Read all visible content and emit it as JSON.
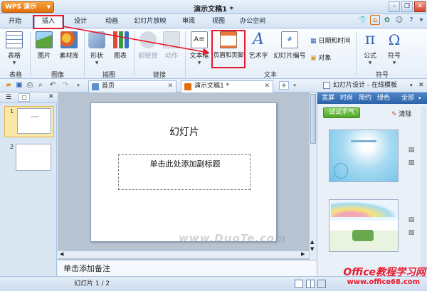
{
  "app": {
    "name": "WPS 演示",
    "doc_title": "演示文稿1 *"
  },
  "menu": {
    "tabs": [
      "开始",
      "插入",
      "设计",
      "动画",
      "幻灯片放映",
      "审阅",
      "视图",
      "办公空间"
    ],
    "active": "插入"
  },
  "ribbon": {
    "buttons": {
      "table": "表格",
      "picture": "图片",
      "clipart": "素材库",
      "shape": "形状",
      "chart": "图表",
      "hyperlink": "超链接",
      "action": "动作",
      "textbox": "文本框",
      "header_footer": "页眉和页脚",
      "wordart": "艺术字",
      "slide_number": "幻灯片编号",
      "datetime": "日期和时间",
      "object": "对象",
      "formula": "公式",
      "symbol": "符号"
    },
    "groups": {
      "table": "表格",
      "image": "图像",
      "illustration": "插图",
      "link": "链接",
      "text": "文本",
      "symbol": "符号"
    }
  },
  "doc_tabs": [
    {
      "label": "首页"
    },
    {
      "label": "演示文稿1 *"
    }
  ],
  "slide": {
    "title": "幻灯片",
    "subtitle_placeholder": "单击此处添加副标题",
    "watermark": "www.DuoTe.com"
  },
  "thumbnails": [
    {
      "num": "1"
    },
    {
      "num": "2"
    }
  ],
  "notes": {
    "placeholder": "单击添加备注"
  },
  "right_panel": {
    "title": "幻灯片设计 - 在线模板",
    "categories": [
      "宽屏",
      "时尚",
      "简约",
      "绿色",
      "全部"
    ],
    "try_button": "试试手气",
    "clear_button": "清除"
  },
  "status": {
    "slide_info": "幻灯片 1 / 2"
  },
  "branding": {
    "line1": "Office教程学习网",
    "line2": "www.office68.com"
  },
  "colors": {
    "accent_orange": "#e26f0c",
    "highlight_red": "#e8192c",
    "panel_blue": "#2d62a8"
  }
}
